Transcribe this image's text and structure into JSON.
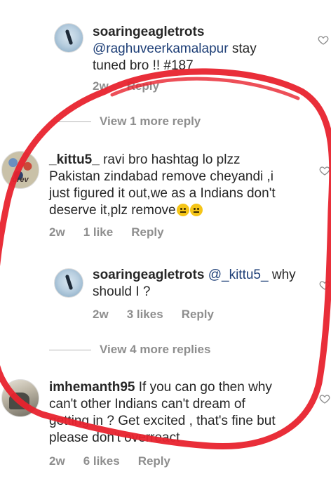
{
  "comments": [
    {
      "username": "soaringeagletrots",
      "mention": "@raghuveerkamalapur",
      "text_line1_after": "stay",
      "text_line2": "tuned bro !! #187",
      "time": "2w",
      "reply_label": "Reply"
    },
    {
      "view_more": "View 1 more reply"
    },
    {
      "username": "_kittu5_",
      "avatar_text": "drev",
      "text_line1": "ravi bro hashtag lo plzz",
      "text_line2": "Pakistan zindabad remove cheyandi ,i",
      "text_line3": "just figured it out,we as a Indians don't",
      "text_line4": "deserve it,plz remove",
      "time": "2w",
      "likes": "1 like",
      "reply_label": "Reply"
    },
    {
      "username": "soaringeagletrots",
      "mention": "@_kittu5_",
      "text_line1_after": "why",
      "text_line2": "should I ?",
      "time": "2w",
      "likes": "3 likes",
      "reply_label": "Reply"
    },
    {
      "view_more": "View 4 more replies"
    },
    {
      "username": "imhemanth95",
      "text_line1": "If you can go then why",
      "text_line2": "can't other Indians can't dream of",
      "text_line3": "getting in ? Get excited , that's fine but",
      "text_line4": "please don't overreact",
      "time": "2w",
      "likes": "6 likes",
      "reply_label": "Reply"
    }
  ],
  "colors": {
    "annotation_red": "#e8232e",
    "meta_gray": "#8e8e8e",
    "mention_blue": "#1e3f77"
  },
  "icons": [
    "like-heart-icon"
  ]
}
